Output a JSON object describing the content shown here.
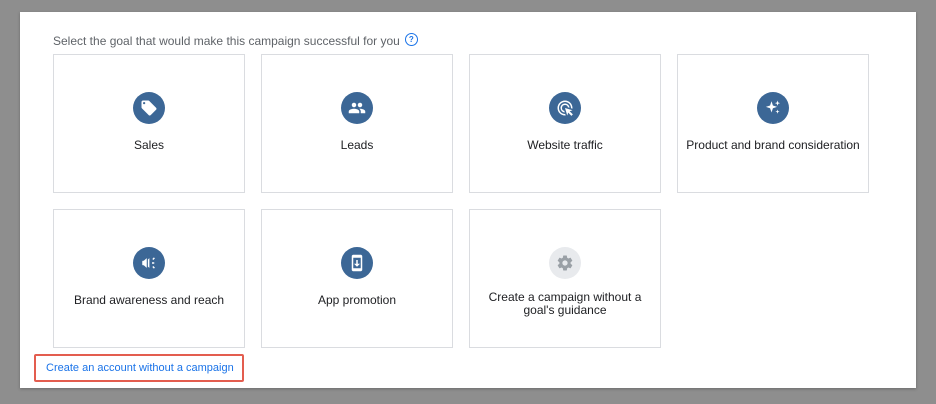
{
  "prompt": {
    "text": "Select the goal that would make this campaign successful for you",
    "help_icon": "help-circle-icon"
  },
  "goals": [
    {
      "label": "Sales",
      "icon": "tag-icon"
    },
    {
      "label": "Leads",
      "icon": "people-icon"
    },
    {
      "label": "Website traffic",
      "icon": "cursor-click-icon"
    },
    {
      "label": "Product and brand consideration",
      "icon": "sparkle-icon"
    },
    {
      "label": "Brand awareness and reach",
      "icon": "megaphone-icon"
    },
    {
      "label": "App promotion",
      "icon": "phone-download-icon"
    },
    {
      "label": "Create a campaign without a goal's guidance",
      "icon": "gear-icon"
    }
  ],
  "footer_link": "Create an account without a campaign",
  "colors": {
    "icon_bg": "#3c6796",
    "icon_bg_neutral": "#e8eaed",
    "link": "#1a73e8",
    "highlight_border": "#e35d4f"
  }
}
